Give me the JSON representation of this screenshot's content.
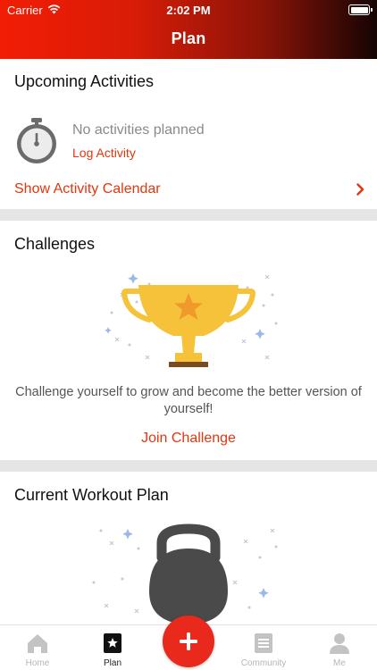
{
  "status_bar": {
    "carrier": "Carrier",
    "time": "2:02 PM"
  },
  "nav": {
    "title": "Plan"
  },
  "upcoming": {
    "title": "Upcoming Activities",
    "empty_text": "No activities planned",
    "log_label": "Log Activity",
    "calendar_label": "Show Activity Calendar"
  },
  "challenges": {
    "title": "Challenges",
    "description": "Challenge yourself to grow and become the better version of yourself!",
    "join_label": "Join Challenge"
  },
  "workout": {
    "title": "Current Workout Plan"
  },
  "tabbar": {
    "tabs": [
      {
        "label": "Home",
        "icon": "home-icon"
      },
      {
        "label": "Plan",
        "icon": "plan-star-icon"
      },
      {
        "label": "Community",
        "icon": "community-icon"
      },
      {
        "label": "Me",
        "icon": "profile-icon"
      }
    ],
    "active_tab": "Plan",
    "fab_icon": "plus-icon"
  },
  "colors": {
    "accent": "#e2360e",
    "fab": "#e8291c",
    "header_gradient_start": "#f21d05",
    "header_gradient_end": "#150403",
    "trophy": "#f5c23a",
    "trophy_star": "#f09a2c"
  }
}
